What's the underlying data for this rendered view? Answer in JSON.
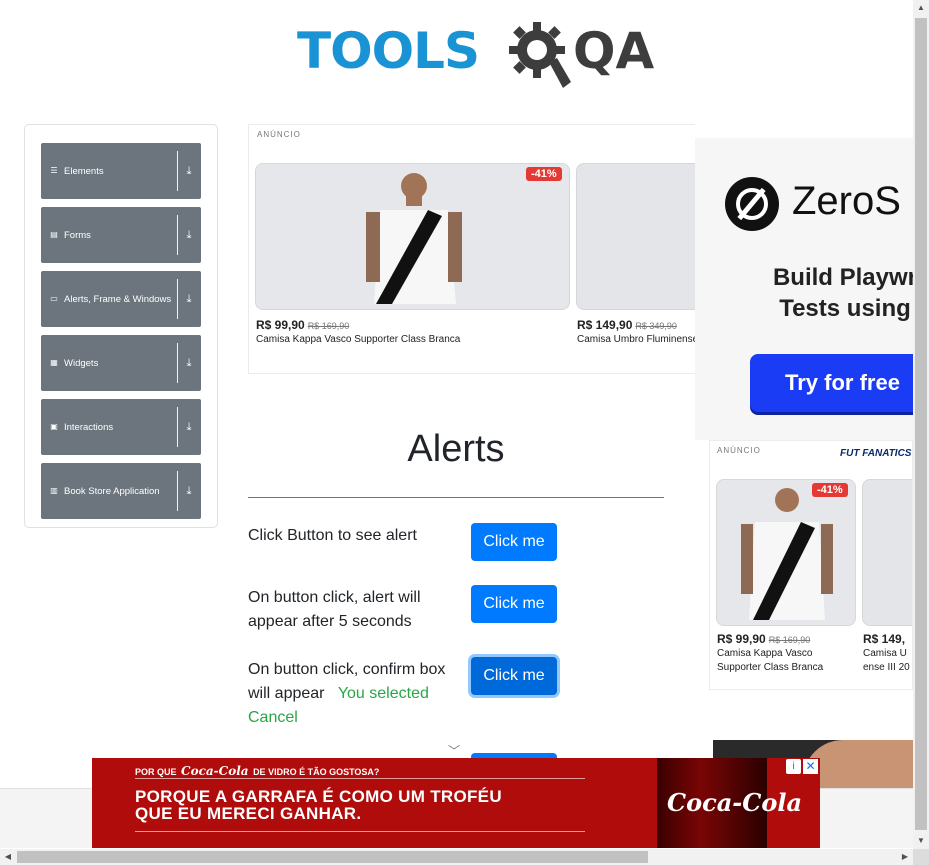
{
  "header": {
    "logo_text": "TOOLS",
    "logo_text2": "QA"
  },
  "sidebar": {
    "groups": [
      {
        "label": "Elements",
        "icon": "list-icon"
      },
      {
        "label": "Forms",
        "icon": "form-icon"
      },
      {
        "label": "Alerts, Frame & Windows",
        "icon": "window-icon"
      },
      {
        "label": "Widgets",
        "icon": "grid-icon"
      },
      {
        "label": "Interactions",
        "icon": "interactions-icon"
      },
      {
        "label": "Book Store Application",
        "icon": "books-icon"
      }
    ]
  },
  "ad_top": {
    "label": "ANÚNCIO",
    "products": [
      {
        "badge": "-41%",
        "price": "R$ 99,90",
        "old_price": "R$ 169,90",
        "name": "Camisa Kappa Vasco Supporter Class Branca"
      },
      {
        "price": "R$ 149,90",
        "old_price": "R$ 349,90",
        "name": "Camisa Umbro Fluminense"
      }
    ]
  },
  "main": {
    "title": "Alerts",
    "rows": [
      {
        "label": "Click Button to see alert",
        "button": "Click me"
      },
      {
        "label": "On button click, alert will appear after 5 seconds",
        "button": "Click me"
      },
      {
        "label": "On button click, confirm box will appear",
        "result": "You selected Cancel",
        "button": "Click me"
      }
    ]
  },
  "ad_right": {
    "brand": "ZeroS",
    "tagline_1": "Build Playwr",
    "tagline_2": "Tests using",
    "cta": "Try for free"
  },
  "ad_right2": {
    "label": "ANÚNCIO",
    "brand": "FUT FANATICS",
    "products": [
      {
        "badge": "-41%",
        "price": "R$ 99,90",
        "old_price": "R$ 169,90",
        "name_1": "Camisa Kappa Vasco",
        "name_2": "Supporter Class Branca"
      },
      {
        "price": "R$ 149,",
        "name_1": "Camisa U",
        "name_2": "ense III 20"
      }
    ]
  },
  "coke_ad": {
    "top_before": "POR QUE",
    "top_brand": "Coca-Cola",
    "top_after": "DE VIDRO É TÃO GOSTOSA?",
    "main_1": "PORQUE A GARRAFA É COMO UM TROFÉU",
    "main_2": "QUE EU MERECI GANHAR.",
    "bottle_label": "Coca-Cola",
    "info": "i",
    "close": "✕"
  },
  "colors": {
    "primary": "#007bff",
    "sidebar": "#6c757d",
    "success": "#28a745",
    "coke_red": "#b00c0c",
    "logo_blue": "#1a93d4"
  }
}
